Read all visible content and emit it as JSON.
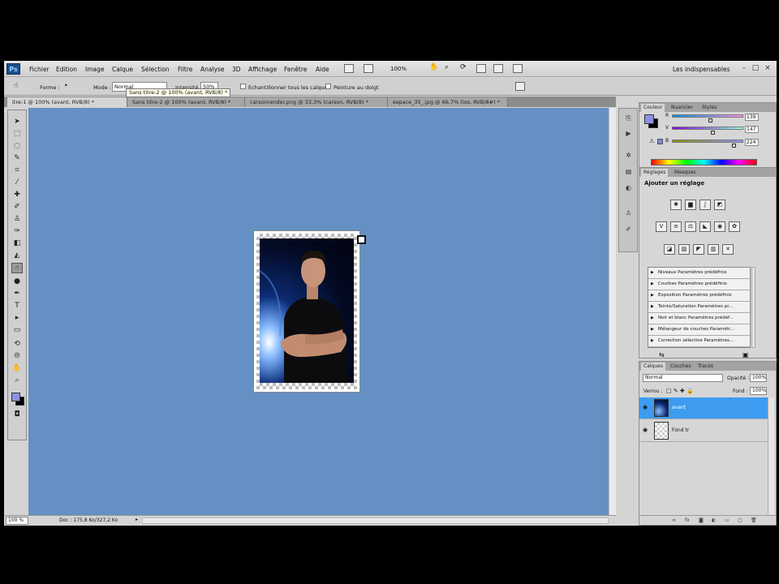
{
  "menubar": {
    "app_icon": "Ps",
    "items": [
      "Fichier",
      "Edition",
      "Image",
      "Calque",
      "Sélection",
      "Filtre",
      "Analyse",
      "3D",
      "Affichage",
      "Fenêtre",
      "Aide"
    ],
    "zoom": "100%",
    "workspace": "Les indispensables",
    "window_buttons": [
      "–",
      "□",
      "×"
    ]
  },
  "options": {
    "forme_label": "Forme :",
    "mode_label": "Mode :",
    "mode_value": "Normal",
    "intensite_label": "Intensité :",
    "intensite_value": "50%",
    "sample_all": "Echantillonner tous les calques",
    "finger_paint": "Peinture au doigt",
    "tooltip": "Sans titre-2 @ 100% (avant, RVB/8) *"
  },
  "tabs": [
    {
      "label": "itre-1 @ 100% (avant, RVB/8) *",
      "active": true
    },
    {
      "label": "Sans titre-2 @ 100% (avant, RVB/8) *",
      "active": false
    },
    {
      "label": "carsonrender.png @ 33,3% (carson, RVB/8) *",
      "active": false
    },
    {
      "label": "espace_35_.jpg @ 66,7% (ios, RVB/8#) *",
      "active": false
    }
  ],
  "status": {
    "zoom": "100 %",
    "doc": "Doc : 175,8 Ko/327,2 Ko"
  },
  "color_panel": {
    "tabs": [
      "Couleur",
      "Nuancier",
      "Styles"
    ],
    "fg": "#8b93e0",
    "bg": "#000000",
    "channels": [
      {
        "label": "R",
        "value": "139",
        "fraction": 0.545
      },
      {
        "label": "V",
        "value": "147",
        "fraction": 0.576
      },
      {
        "label": "B",
        "value": "224",
        "fraction": 0.878
      }
    ]
  },
  "adj_panel": {
    "tabs": [
      "Réglages",
      "Masques"
    ],
    "title": "Ajouter un réglage",
    "presets": [
      "Niveaux Paramètres prédéfinis",
      "Courbes Paramètres prédéfinis",
      "Exposition Paramètres prédéfinis",
      "Teinte/Saturation Paramètres pr...",
      "Noir et blanc Paramètres prédéf...",
      "Mélangeur de couches Paramètr...",
      "Correction sélective Paramètres..."
    ]
  },
  "layers_panel": {
    "tabs": [
      "Calques",
      "Couches",
      "Tracés"
    ],
    "blend_mode": "Normal",
    "opacity_label": "Opacité :",
    "opacity_value": "100%",
    "lock_label": "Verrou :",
    "fill_label": "Fond :",
    "fill_value": "100%",
    "layers": [
      {
        "name": "avant",
        "selected": true
      },
      {
        "name": "Fond tr",
        "selected": false
      }
    ]
  }
}
